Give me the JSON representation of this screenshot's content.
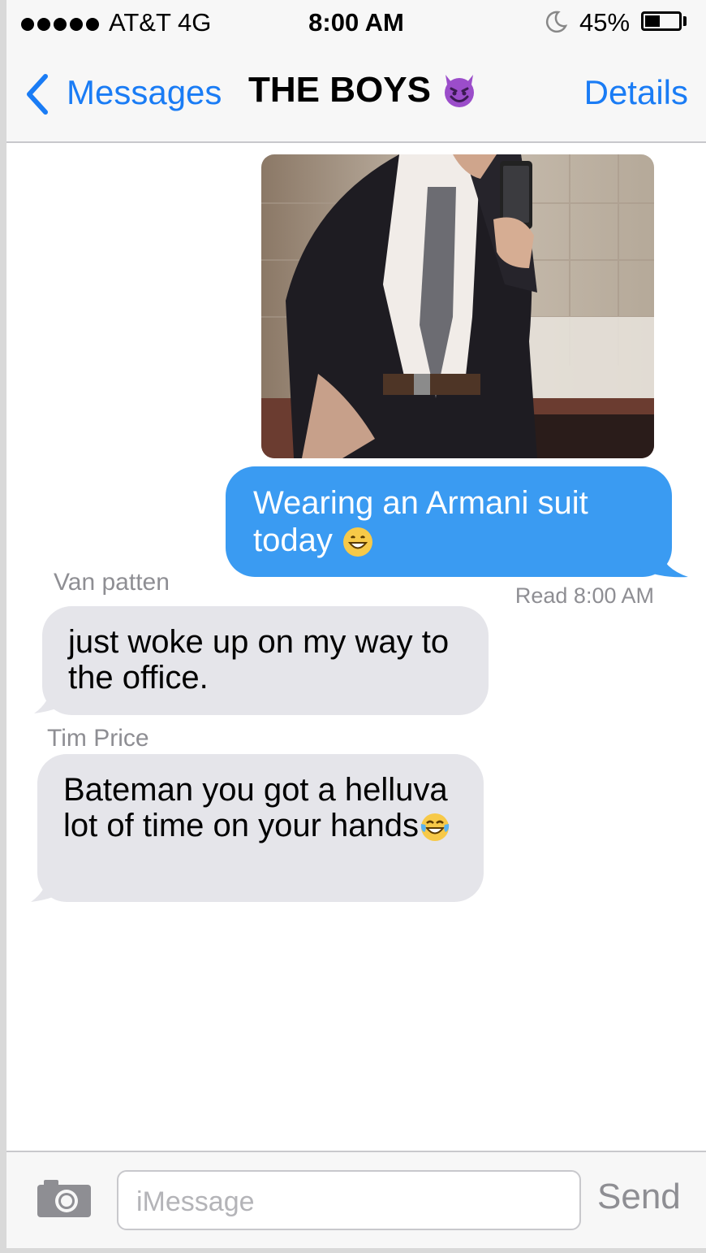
{
  "status_bar": {
    "carrier": "AT&T  4G",
    "time": "8:00 AM",
    "battery": "45%",
    "battery_level": 0.45,
    "icons": [
      "signal-dots-icon",
      "moon-icon",
      "battery-icon"
    ]
  },
  "nav": {
    "back_label": "Messages",
    "title": "THE BOYS",
    "title_emoji": "smiling-devil-icon",
    "details_label": "Details"
  },
  "messages": [
    {
      "kind": "photo",
      "direction": "sent",
      "description_icon": "photo-attachment"
    },
    {
      "kind": "text",
      "direction": "sent",
      "text": "Wearing an Armani suit today",
      "emoji": "grinning-face-icon"
    },
    {
      "kind": "receipt",
      "text": "Read 8:00 AM"
    },
    {
      "kind": "text",
      "direction": "received",
      "sender": "Van patten",
      "text": "just woke up on my way to the office."
    },
    {
      "kind": "text",
      "direction": "received",
      "sender": "Tim Price",
      "text": "Bateman you got a helluva lot of time on your hands",
      "emoji": "tears-of-joy-icon"
    }
  ],
  "input_bar": {
    "placeholder": "iMessage",
    "send_label": "Send"
  },
  "colors": {
    "ios_blue": "#1a7cf5",
    "sent_bubble": "#3a9bf2",
    "received_bubble": "#e5e5ea",
    "gray_text": "#8e8e93"
  }
}
